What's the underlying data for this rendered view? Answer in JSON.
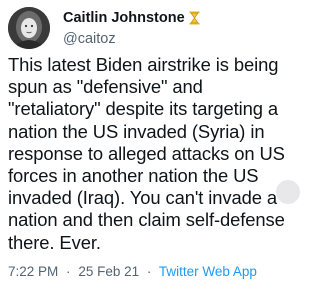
{
  "tweet": {
    "author": {
      "display_name": "Caitlin Johnstone",
      "handle": "@caitoz",
      "name_emoji_icon": "hourglass-icon"
    },
    "text": "This latest Biden airstrike is being spun as \"defensive\" and \"retaliatory\" despite its targeting a nation the US invaded (Syria) in response to alleged attacks on US forces in another nation the US invaded (Iraq). You can't invade a nation and then claim self-defense there. Ever.",
    "time": "7:22 PM",
    "separator": "·",
    "date": "25 Feb 21",
    "source": "Twitter Web App"
  },
  "colors": {
    "text_primary": "#0f1419",
    "text_secondary": "#536471",
    "link_blue": "#1d9bf0",
    "hourglass_gold": "#e8b018"
  },
  "icons": [
    "avatar",
    "hourglass-icon",
    "more-options-icon"
  ]
}
